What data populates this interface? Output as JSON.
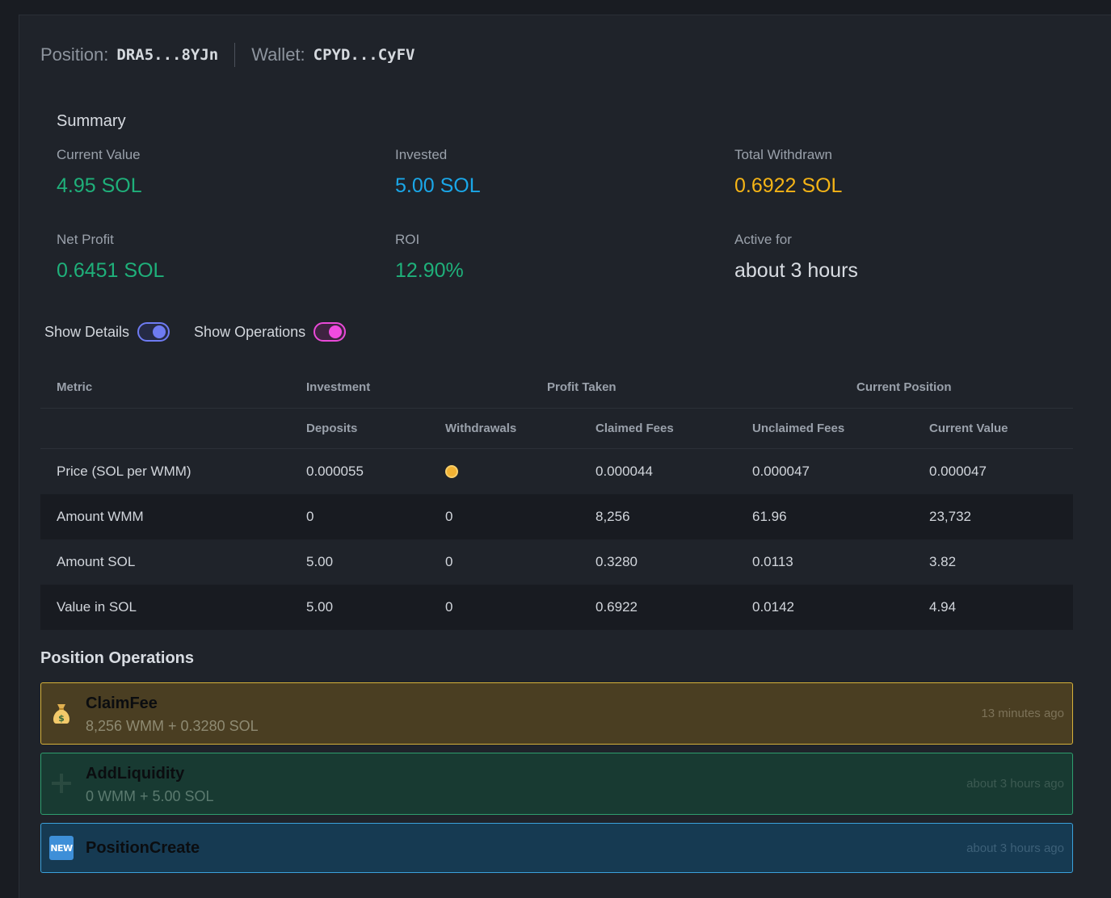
{
  "header": {
    "position_label": "Position:",
    "position_value": "DRA5...8YJn",
    "wallet_label": "Wallet:",
    "wallet_value": "CPYD...CyFV"
  },
  "summary": {
    "title": "Summary",
    "current_value": {
      "label": "Current Value",
      "value": "4.95 SOL",
      "color": "#1fb07a"
    },
    "invested": {
      "label": "Invested",
      "value": "5.00 SOL",
      "color": "#1aa7e8"
    },
    "total_withdrawn": {
      "label": "Total Withdrawn",
      "value": "0.6922 SOL",
      "color": "#f5b416"
    },
    "net_profit": {
      "label": "Net Profit",
      "value": "0.6451 SOL",
      "color": "#1fb07a"
    },
    "roi": {
      "label": "ROI",
      "value": "12.90%",
      "color": "#1fb07a"
    },
    "active_for": {
      "label": "Active for",
      "value": "about 3 hours",
      "color": "#d8dce2"
    }
  },
  "toggles": {
    "show_details": {
      "label": "Show Details",
      "on": true,
      "color": "#6e7bf2"
    },
    "show_operations": {
      "label": "Show Operations",
      "on": true,
      "color": "#f04be0"
    }
  },
  "table": {
    "groups": {
      "metric": "Metric",
      "investment": "Investment",
      "profit_taken": "Profit Taken",
      "current_position": "Current Position"
    },
    "columns": [
      "Deposits",
      "Withdrawals",
      "Claimed Fees",
      "Unclaimed Fees",
      "Current Value"
    ],
    "rows": [
      {
        "metric": "Price (SOL per WMM)",
        "deposits": "0.000055",
        "withdrawals": "",
        "withdrawals_icon": "coin-icon",
        "claimed_fees": "0.000044",
        "unclaimed_fees": "0.000047",
        "current_value": "0.000047"
      },
      {
        "metric": "Amount WMM",
        "deposits": "0",
        "withdrawals": "0",
        "claimed_fees": "8,256",
        "unclaimed_fees": "61.96",
        "current_value": "23,732"
      },
      {
        "metric": "Amount SOL",
        "deposits": "5.00",
        "withdrawals": "0",
        "claimed_fees": "0.3280",
        "unclaimed_fees": "0.0113",
        "current_value": "3.82"
      },
      {
        "metric": "Value in SOL",
        "deposits": "5.00",
        "withdrawals": "0",
        "claimed_fees": "0.6922",
        "unclaimed_fees": "0.0142",
        "current_value": "4.94"
      }
    ]
  },
  "operations": {
    "title": "Position Operations",
    "items": [
      {
        "type": "ClaimFee",
        "icon": "money-bag-icon",
        "detail": "8,256 WMM + 0.3280 SOL",
        "time": "13 minutes ago",
        "color": "#d6b13a"
      },
      {
        "type": "AddLiquidity",
        "icon": "plus-icon",
        "detail": "0 WMM + 5.00 SOL",
        "time": "about 3 hours ago",
        "color": "#2e9e6e"
      },
      {
        "type": "PositionCreate",
        "icon": "new-badge-icon",
        "badge_text": "NEW",
        "detail": "",
        "time": "about 3 hours ago",
        "color": "#3ba1db"
      }
    ]
  }
}
